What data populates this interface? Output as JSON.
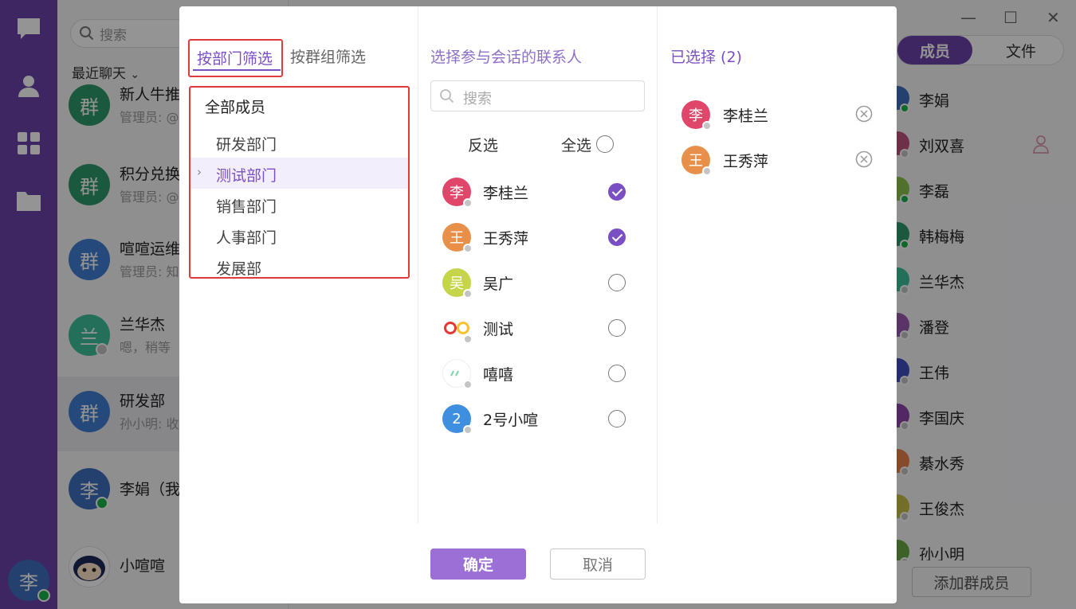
{
  "nav": {
    "avatar_text": "李",
    "icons": [
      "chat-bubble-icon",
      "contacts-icon",
      "apps-grid-icon",
      "folder-icon"
    ]
  },
  "chatlist": {
    "search_placeholder": "搜索",
    "recent_label": "最近聊天",
    "items": [
      {
        "avatar": "群",
        "name": "新人牛推",
        "preview": "管理员: @",
        "color": "#2e9a6a"
      },
      {
        "avatar": "群",
        "name": "积分兑换",
        "preview": "管理员: @",
        "color": "#2e9a6a"
      },
      {
        "avatar": "群",
        "name": "喧喧运维",
        "preview": "管理员: 知",
        "color": "#3f7fd2"
      },
      {
        "avatar": "兰",
        "name": "兰华杰",
        "preview": "嗯，稍等",
        "color": "#3fbf9a"
      },
      {
        "avatar": "群",
        "name": "研发部",
        "preview": "孙小明: 收",
        "color": "#3f7fd2"
      },
      {
        "avatar": "李",
        "name": "李娟（我",
        "preview": "",
        "color": "#3e6fbe"
      },
      {
        "avatar": "",
        "name": "小喧喧",
        "preview": "",
        "color": "#ffffff"
      }
    ]
  },
  "rightpanel": {
    "tab_members": "成员",
    "tab_files": "文件",
    "members": [
      "李娟",
      "刘双喜",
      "李磊",
      "韩梅梅",
      "兰华杰",
      "潘登",
      "王伟",
      "李国庆",
      "綦水秀",
      "王俊杰",
      "孙小明"
    ],
    "add_button": "添加群成员"
  },
  "dialog": {
    "filter_tabs": {
      "by_dept": "按部门筛选",
      "by_group": "按群组筛选"
    },
    "all_members": "全部成员",
    "departments": [
      "研发部门",
      "测试部门",
      "销售部门",
      "人事部门",
      "发展部"
    ],
    "selected_department": "测试部门",
    "middle_title": "选择参与会话的联系人",
    "search_placeholder": "搜索",
    "invert_label": "反选",
    "select_all_label": "全选",
    "contacts": [
      {
        "avatar": "李",
        "name": "李桂兰",
        "checked": true,
        "color": "#e0466a"
      },
      {
        "avatar": "王",
        "name": "王秀萍",
        "checked": true,
        "color": "#e8904a"
      },
      {
        "avatar": "吴",
        "name": "吴广",
        "checked": false,
        "color": "#c6d44a"
      },
      {
        "avatar": "",
        "name": "测试",
        "checked": false,
        "color": "#ffffff"
      },
      {
        "avatar": "",
        "name": "嘻嘻",
        "checked": false,
        "color": "#ffffff"
      },
      {
        "avatar": "2",
        "name": "2号小喧",
        "checked": false,
        "color": "#3f8fe0"
      }
    ],
    "selected_title": "已选择 (2)",
    "selected": [
      {
        "avatar": "李",
        "name": "李桂兰",
        "color": "#e0466a"
      },
      {
        "avatar": "王",
        "name": "王秀萍",
        "color": "#e8904a"
      }
    ],
    "ok_label": "确定",
    "cancel_label": "取消"
  }
}
